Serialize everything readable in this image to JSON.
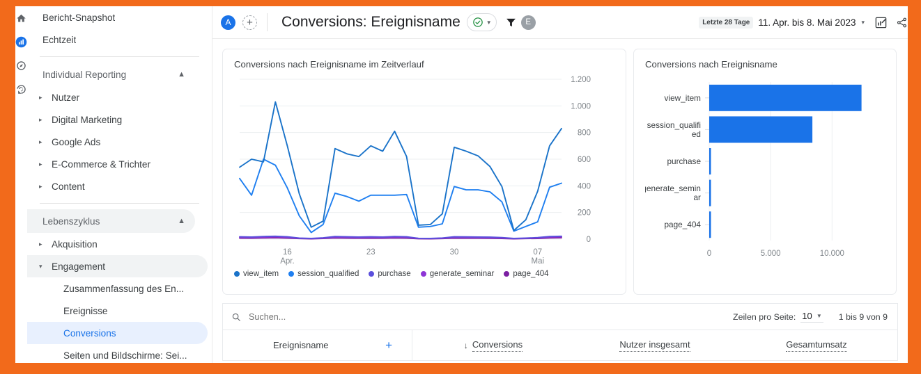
{
  "app": {
    "accent": "#1a73e8",
    "frame_color": "#f26a1b"
  },
  "rail": {
    "items": [
      {
        "name": "home-icon",
        "label": "Startseite"
      },
      {
        "name": "reports-icon",
        "label": "Berichte"
      },
      {
        "name": "explore-icon",
        "label": "Explorative Datenanalyse"
      },
      {
        "name": "advertising-icon",
        "label": "Werbung"
      }
    ]
  },
  "sidebar": {
    "top_items": [
      {
        "label": "Bericht-Snapshot"
      },
      {
        "label": "Echtzeit"
      }
    ],
    "groups": [
      {
        "label": "Individual Reporting",
        "expanded": true,
        "items": [
          {
            "label": "Nutzer",
            "caret": "▸"
          },
          {
            "label": "Digital Marketing",
            "caret": "▸"
          },
          {
            "label": "Google Ads",
            "caret": "▸"
          },
          {
            "label": "E-Commerce & Trichter",
            "caret": "▸"
          },
          {
            "label": "Content",
            "caret": "▸"
          }
        ]
      },
      {
        "label": "Lebenszyklus",
        "expanded": true,
        "items": [
          {
            "label": "Akquisition",
            "caret": "▸"
          },
          {
            "label": "Engagement",
            "caret": "▾",
            "highlighted": true
          },
          {
            "label": "Zusammenfassung des En...",
            "sub": true
          },
          {
            "label": "Ereignisse",
            "sub": true
          },
          {
            "label": "Conversions",
            "sub": true,
            "active": true
          },
          {
            "label": "Seiten und Bildschirme: Sei...",
            "sub": true
          }
        ]
      }
    ]
  },
  "header": {
    "avatar_initial": "A",
    "add_label": "+",
    "title": "Conversions: Ereignisname",
    "check_chip": "✓",
    "chip_caret": "▾",
    "filter_initial": "E",
    "date_badge": "Letzte 28 Tage",
    "date_range": "11. Apr. bis 8. Mai 2023",
    "date_caret": "▾"
  },
  "main": {
    "line_card_title": "Conversions nach Ereignisname im Zeitverlauf",
    "bar_card_title": "Conversions nach Ereignisname"
  },
  "table": {
    "search_placeholder": "Suchen...",
    "rows_per_page_label": "Zeilen pro Seite:",
    "rows_per_page_value": "10",
    "range_text": "1 bis 9 von 9",
    "dimension_header": "Ereignisname",
    "add_dimension": "+",
    "columns": [
      {
        "label": "Conversions",
        "sorted": true,
        "sort_arrow": "↓"
      },
      {
        "label": "Nutzer insgesamt",
        "sorted": false
      },
      {
        "label": "Gesamtumsatz",
        "sorted": false
      }
    ]
  },
  "chart_data": [
    {
      "type": "line",
      "title": "Conversions nach Ereignisname im Zeitverlauf",
      "xlabel": "",
      "ylabel": "",
      "ylim": [
        0,
        1200
      ],
      "yticks": [
        0,
        200,
        400,
        600,
        800,
        1000,
        1200
      ],
      "ytick_labels": [
        "0",
        "200",
        "400",
        "600",
        "800",
        "1.000",
        "1.200"
      ],
      "xtick_labels": [
        "16\nApr.",
        "23",
        "30",
        "07\nMai"
      ],
      "xtick_positions": [
        4,
        11,
        18,
        25
      ],
      "grid": true,
      "legend_position": "bottom",
      "x": [
        0,
        1,
        2,
        3,
        4,
        5,
        6,
        7,
        8,
        9,
        10,
        11,
        12,
        13,
        14,
        15,
        16,
        17,
        18,
        19,
        20,
        21,
        22,
        23,
        24,
        25,
        26,
        27
      ],
      "series": [
        {
          "name": "view_item",
          "color": "#1a73c9",
          "values": [
            540,
            600,
            580,
            1030,
            700,
            340,
            90,
            135,
            680,
            640,
            620,
            700,
            660,
            810,
            620,
            105,
            110,
            190,
            690,
            660,
            625,
            545,
            395,
            65,
            145,
            360,
            700,
            830
          ]
        },
        {
          "name": "session_qualified",
          "color": "#1f7ff0",
          "values": [
            455,
            330,
            600,
            555,
            385,
            175,
            50,
            110,
            345,
            320,
            285,
            330,
            330,
            330,
            335,
            90,
            95,
            115,
            395,
            370,
            370,
            355,
            280,
            60,
            95,
            130,
            390,
            420
          ]
        },
        {
          "name": "purchase",
          "color": "#5b4fdc",
          "values": [
            18,
            16,
            20,
            22,
            18,
            8,
            5,
            10,
            20,
            18,
            16,
            18,
            16,
            20,
            18,
            6,
            5,
            9,
            18,
            17,
            16,
            15,
            12,
            5,
            8,
            12,
            20,
            22
          ]
        },
        {
          "name": "generate_seminar",
          "color": "#8e35d6",
          "values": [
            14,
            12,
            15,
            18,
            14,
            6,
            4,
            8,
            16,
            14,
            12,
            14,
            12,
            16,
            14,
            5,
            4,
            7,
            14,
            13,
            12,
            11,
            9,
            4,
            6,
            9,
            16,
            18
          ]
        },
        {
          "name": "page_404",
          "color": "#7b1fa2",
          "values": [
            8,
            7,
            9,
            10,
            8,
            4,
            2,
            5,
            9,
            8,
            7,
            8,
            7,
            9,
            8,
            3,
            2,
            4,
            8,
            7,
            7,
            6,
            5,
            2,
            4,
            5,
            9,
            10
          ]
        }
      ]
    },
    {
      "type": "bar",
      "orientation": "horizontal",
      "title": "Conversions nach Ereignisname",
      "categories": [
        "view_item",
        "session_qualified",
        "purchase",
        "generate_seminar",
        "page_404"
      ],
      "category_labels": [
        "view_item",
        "session_qualifi\ned",
        "purchase",
        "generate_semin\nar",
        "page_404"
      ],
      "values": [
        12400,
        8400,
        95,
        90,
        30
      ],
      "bar_color": "#1a73e8",
      "xlim": [
        0,
        13500
      ],
      "xticks": [
        0,
        5000,
        10000
      ],
      "xtick_labels": [
        "0",
        "5.000",
        "10.000"
      ],
      "grid": true
    }
  ]
}
